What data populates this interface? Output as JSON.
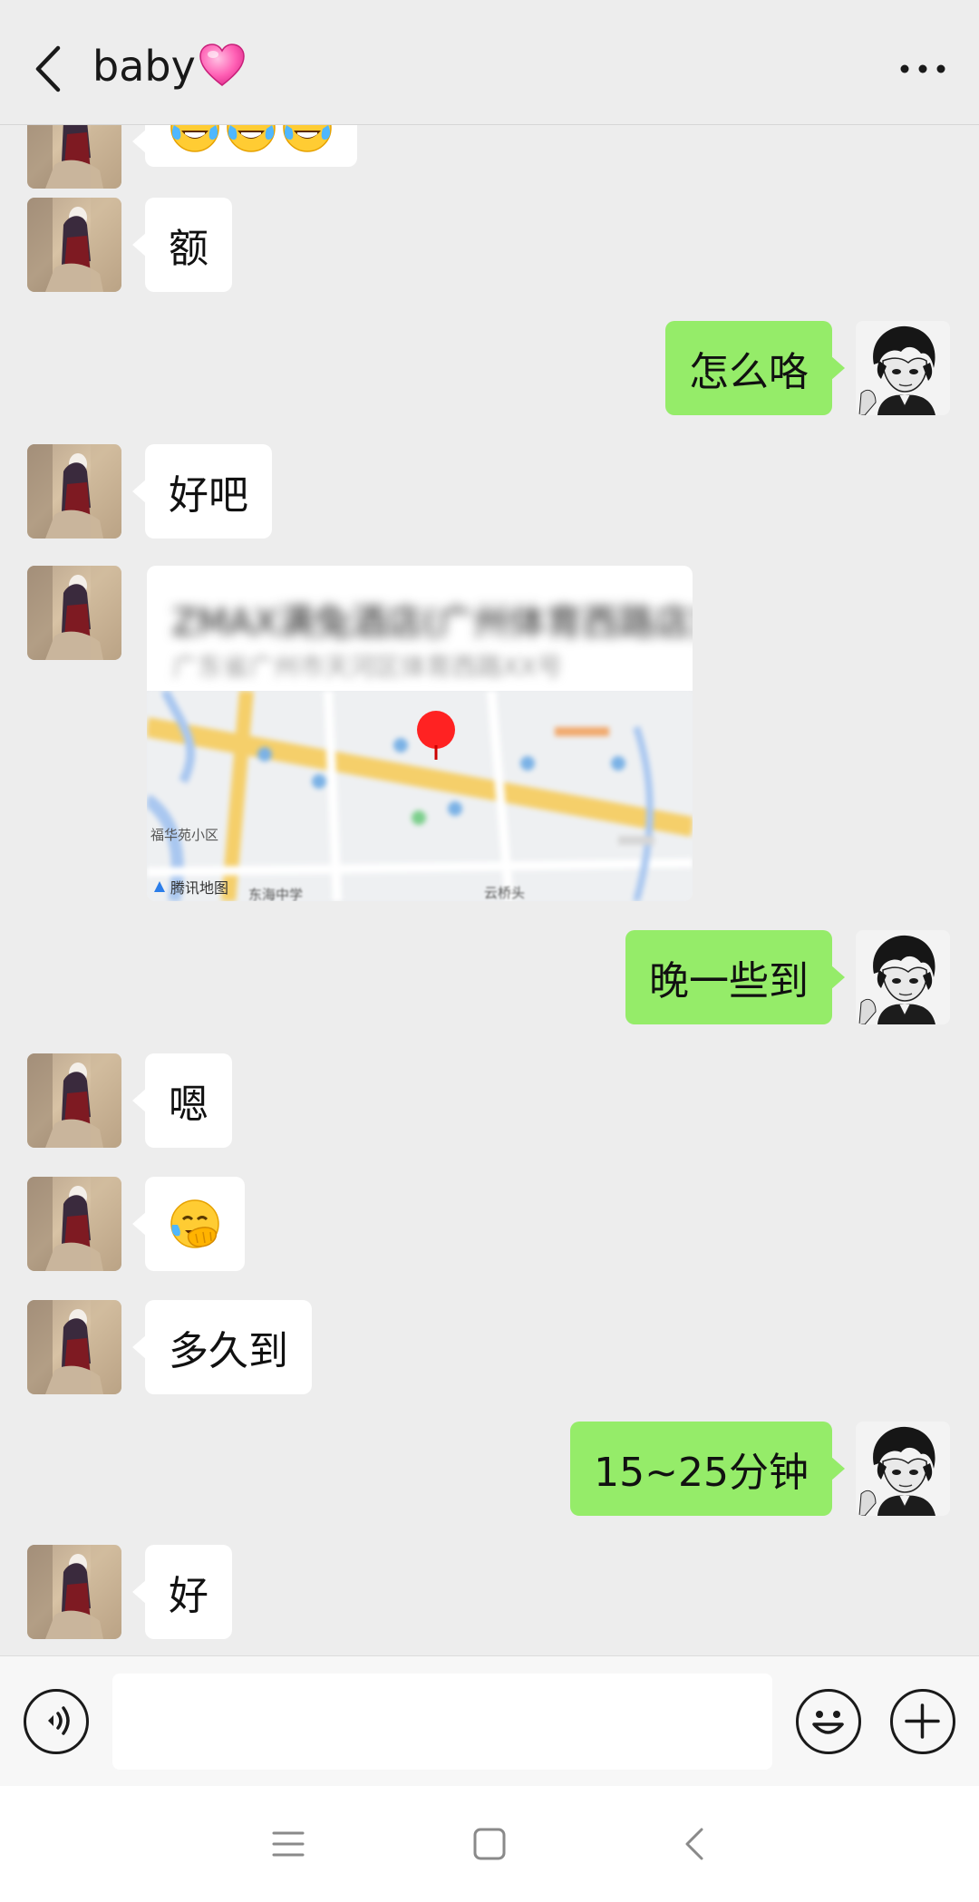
{
  "header": {
    "title": "baby",
    "back_icon": "chevron-left-icon",
    "more_icon": "more-dots-icon",
    "heart_icon": "pink-heart-emoji"
  },
  "messages": [
    {
      "side": "in",
      "type": "emoji",
      "content": "😂😂😂",
      "partial": true
    },
    {
      "side": "in",
      "type": "text",
      "content": "额"
    },
    {
      "side": "out",
      "type": "text",
      "content": "怎么咯"
    },
    {
      "side": "in",
      "type": "text",
      "content": "好吧"
    },
    {
      "side": "in",
      "type": "location",
      "title": "ZMAX满兔酒店(广州体育西路店)",
      "address": "广东省广州市天河区体育西路XX号",
      "map_credit": "腾讯地图",
      "map_labels": [
        "福华苑小区",
        "云桥头",
        "东海中学"
      ]
    },
    {
      "side": "out",
      "type": "text",
      "content": "晚一些到"
    },
    {
      "side": "in",
      "type": "text",
      "content": "嗯"
    },
    {
      "side": "in",
      "type": "emoji",
      "content": "face-palm-laugh-emoji"
    },
    {
      "side": "in",
      "type": "text",
      "content": "多久到"
    },
    {
      "side": "out",
      "type": "text",
      "content": "15~25分钟"
    },
    {
      "side": "in",
      "type": "text",
      "content": "好"
    }
  ],
  "inputbar": {
    "voice_icon": "voice-icon",
    "emoji_icon": "smiley-icon",
    "plus_icon": "plus-icon",
    "text_value": ""
  },
  "navbar": {
    "menu_icon": "menu-icon",
    "home_icon": "square-home-icon",
    "back_icon": "triangle-back-icon"
  },
  "colors": {
    "background": "#ededed",
    "out_bubble": "#95ec69",
    "in_bubble": "#ffffff"
  }
}
